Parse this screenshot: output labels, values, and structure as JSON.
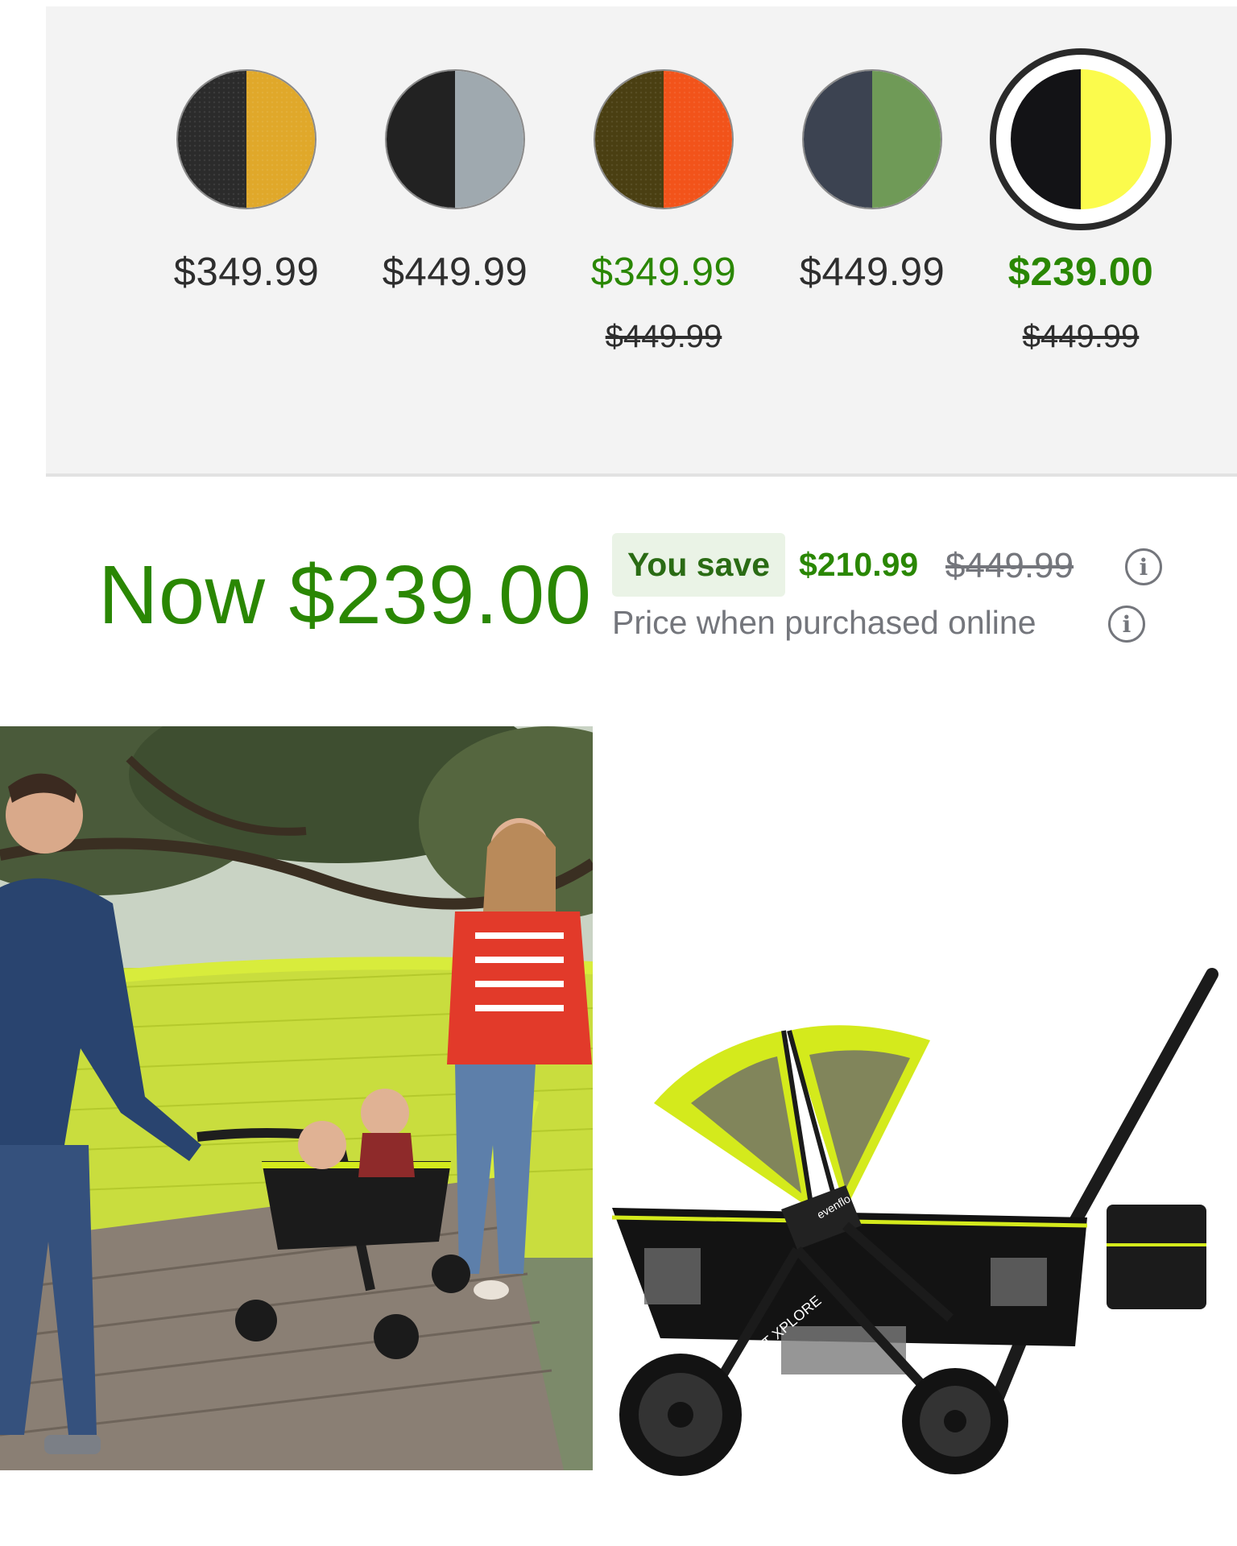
{
  "swatches": [
    {
      "name": "Black and Mustard",
      "colors": [
        "#2b2b2b",
        "#e0a82a"
      ],
      "price": "$349.99",
      "was": "",
      "sale": false,
      "selected": false
    },
    {
      "name": "Black and Gray",
      "colors": [
        "#222222",
        "#9fa9af"
      ],
      "price": "$449.99",
      "was": "",
      "sale": false,
      "selected": false
    },
    {
      "name": "Olive and Orange",
      "colors": [
        "#4a3f12",
        "#f2531a"
      ],
      "price": "$349.99",
      "was": "$449.99",
      "sale": true,
      "selected": false
    },
    {
      "name": "Navy and Green",
      "colors": [
        "#3c4351",
        "#6f9a57"
      ],
      "price": "$449.99",
      "was": "",
      "sale": false,
      "selected": false
    },
    {
      "name": "Black and Yellow",
      "colors": [
        "#131316",
        "#fbfb4c"
      ],
      "price": "$239.00",
      "was": "$449.99",
      "sale": true,
      "selected": true
    }
  ],
  "price": {
    "now": "Now $239.00",
    "you_save_label": "You save",
    "save_amount": "$210.99",
    "was": "$449.99",
    "online_note": "Price when purchased online",
    "info_glyph": "i"
  },
  "images": {
    "lifestyle": "family-wagon-photo",
    "product": "stroller-wagon-product-photo",
    "product_brand": "evenflo",
    "product_model": "PIVOT XPLORE"
  },
  "colors": {
    "accent_green": "#2a8703",
    "muted_text": "#74767c",
    "wagon_lime": "#d4ea1c"
  }
}
